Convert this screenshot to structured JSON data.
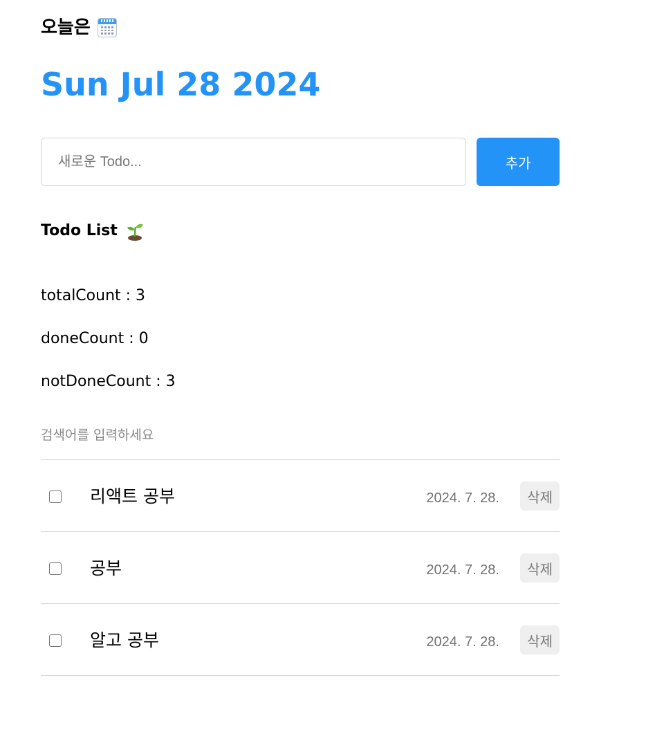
{
  "header": {
    "label": "오늘은",
    "date": "Sun Jul 28 2024"
  },
  "editor": {
    "placeholder": "새로운 Todo...",
    "value": "",
    "add_label": "추가"
  },
  "list": {
    "title": "Todo List",
    "stats": {
      "total": "totalCount : 3",
      "done": "doneCount : 0",
      "not_done": "notDoneCount : 3"
    },
    "search_placeholder": "검색어를 입력하세요",
    "delete_label": "삭제",
    "items": [
      {
        "content": "리액트 공부",
        "date": "2024. 7. 28.",
        "done": false
      },
      {
        "content": "공부",
        "date": "2024. 7. 28.",
        "done": false
      },
      {
        "content": "알고 공부",
        "date": "2024. 7. 28.",
        "done": false
      }
    ]
  },
  "colors": {
    "accent": "#2393f7",
    "divider": "#d6d6d6",
    "delete_bg": "#efefef"
  },
  "icons": {
    "header_icon": "calendar-icon",
    "list_icon": "sprout-icon"
  }
}
